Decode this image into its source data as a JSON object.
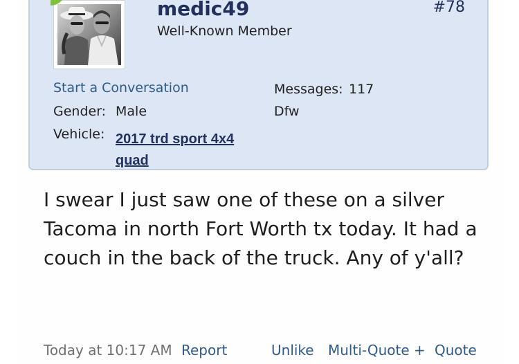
{
  "post": {
    "number": "#78",
    "user": {
      "username": "medic49",
      "title": "Well-Known Member",
      "start_conversation": "Start a Conversation",
      "gender_label": "Gender:",
      "gender_value": "Male",
      "vehicle_label": "Vehicle:",
      "vehicle_value": "2017 trd sport 4x4 quad",
      "messages_label": "Messages:",
      "messages_value": "117",
      "location": "Dfw"
    },
    "body": "I swear I just saw one of these on a silver Tacoma in north Fort Worth tx today. It had a couch in the back of the truck. Any of y'all?",
    "footer": {
      "date": "Today at 10:17 AM",
      "report": "Report",
      "unlike": "Unlike",
      "multi_quote": "Multi-Quote +",
      "quote": "Quote"
    }
  },
  "colors": {
    "link": "#2f5b8c",
    "username": "#23305d",
    "card_background": "#dce6f4",
    "online_indicator": "#7cc23d"
  }
}
